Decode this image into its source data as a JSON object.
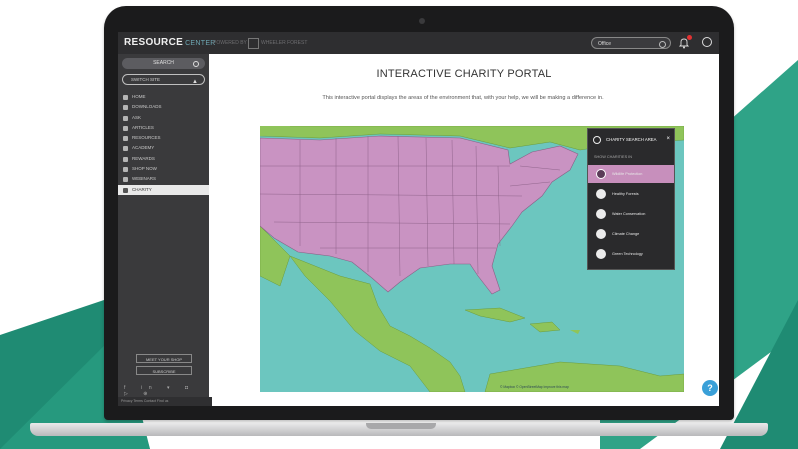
{
  "colors": {
    "teal_dark": "#1f8b73",
    "teal_light": "#2fa387",
    "land_us": "#c993c2",
    "land_other": "#8fc45a",
    "water": "#6cc6bf",
    "panel_selected": "#c78fbc"
  },
  "header": {
    "logo_main": "RESOURCE",
    "logo_sub": "CENTER",
    "ghost_text_1": "POWERED BY",
    "ghost_text_2": "WHEELER FOREST",
    "search_value": "Office",
    "bell_icon": "bell-icon",
    "user_icon": "user-circle-icon"
  },
  "sidebar": {
    "search_label": "SEARCH",
    "switch_label": "SWITCH SITE",
    "items": [
      {
        "label": "HOME",
        "icon": "home-icon"
      },
      {
        "label": "DOWNLOADS",
        "icon": "download-icon"
      },
      {
        "label": "ASK",
        "icon": "ask-icon"
      },
      {
        "label": "ARTICLES",
        "icon": "articles-icon"
      },
      {
        "label": "RESOURCES",
        "icon": "resources-icon"
      },
      {
        "label": "ACADEMY",
        "icon": "academy-icon"
      },
      {
        "label": "REWARDS",
        "icon": "rewards-icon"
      },
      {
        "label": "SHOP NOW",
        "icon": "shop-icon"
      },
      {
        "label": "WEBINARS",
        "icon": "webinar-icon"
      },
      {
        "label": "CHARITY",
        "icon": "heart-icon"
      }
    ],
    "btn_meet": "MEET YOUR SHOP",
    "btn_subscribe": "SUBSCRIBE",
    "social": "f in ▾ ◘ ▷ ⊕",
    "footer": "Privacy   Terms   Contact   Find us"
  },
  "main": {
    "title": "INTERACTIVE CHARITY PORTAL",
    "description": "This interactive portal displays the areas of the environment that, with your help, we will be making a difference in."
  },
  "panel": {
    "title": "CHARITY SEARCH AREA",
    "subtitle": "SHOW CHARITIES IN",
    "items": [
      {
        "label": "Wildlife Protection",
        "icon": "paw-icon"
      },
      {
        "label": "Healthy Forests",
        "icon": "tree-icon"
      },
      {
        "label": "Water Conservation",
        "icon": "water-drop-icon"
      },
      {
        "label": "Climate Change",
        "icon": "thermometer-icon"
      },
      {
        "label": "Green Technology",
        "icon": "leaf-icon"
      }
    ]
  },
  "map": {
    "attribution": "© Mapbox © OpenStreetMap  Improve this map"
  },
  "help_label": "?"
}
